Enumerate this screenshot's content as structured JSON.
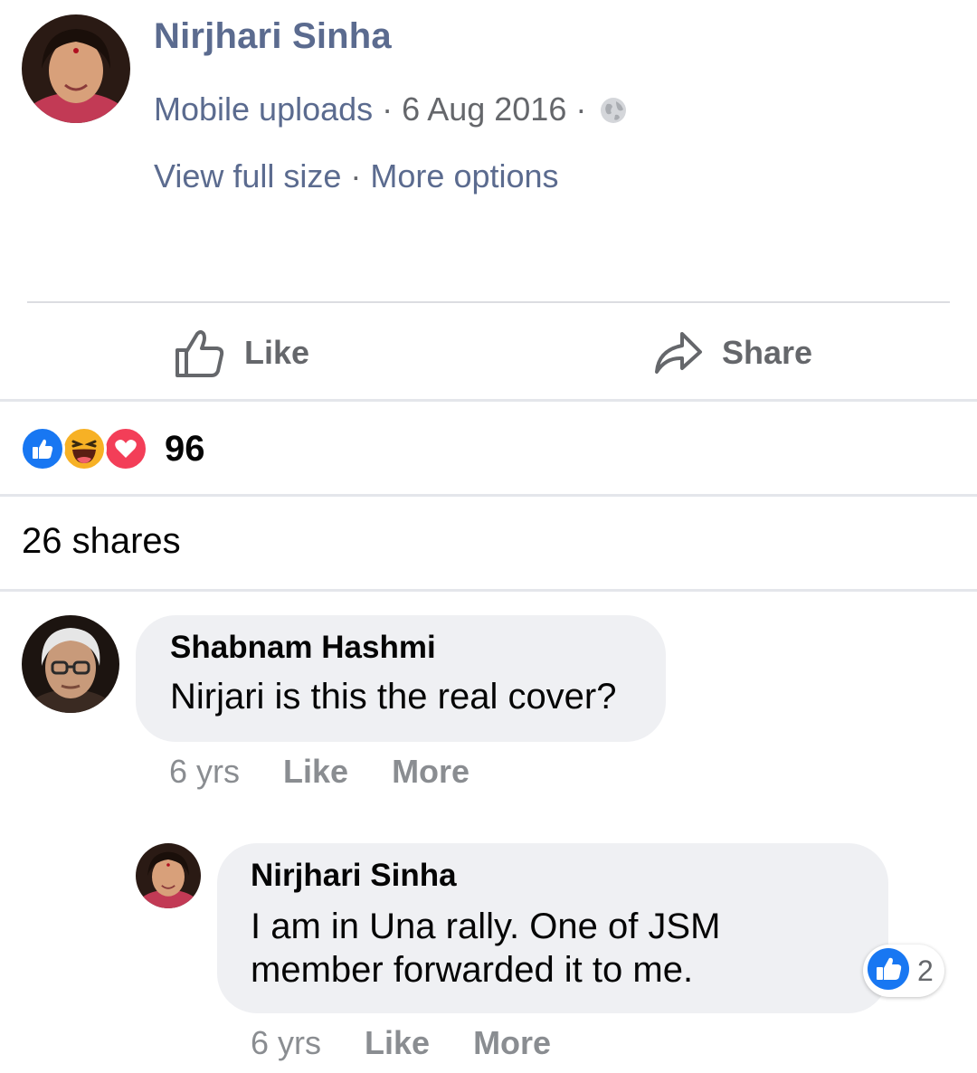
{
  "post": {
    "author": "Nirjhari Sinha",
    "album": "Mobile uploads",
    "separator": "·",
    "date": "6 Aug 2016",
    "privacy_icon": "globe-icon",
    "view_full_size": "View full size",
    "more_options": "More options"
  },
  "actions": {
    "like_label": "Like",
    "share_label": "Share"
  },
  "reactions": {
    "types": [
      "like",
      "haha",
      "love"
    ],
    "count": "96"
  },
  "shares": "26 shares",
  "comments": [
    {
      "author": "Shabnam Hashmi",
      "text": "Nirjari is this the real cover?",
      "time": "6 yrs",
      "like_label": "Like",
      "more_label": "More"
    },
    {
      "author": "Nirjhari Sinha",
      "text_line1": "I am in Una rally. One of JSM",
      "text_line2": "member forwarded it to me.",
      "time": "6 yrs",
      "like_label": "Like",
      "more_label": "More",
      "reaction_count": "2"
    }
  ],
  "colors": {
    "link": "#5b6b8f",
    "muted": "#65676b",
    "like_blue": "#1877f2",
    "love_red": "#f33e58",
    "haha_yellow": "#f7b125",
    "bubble": "#eff0f3"
  }
}
